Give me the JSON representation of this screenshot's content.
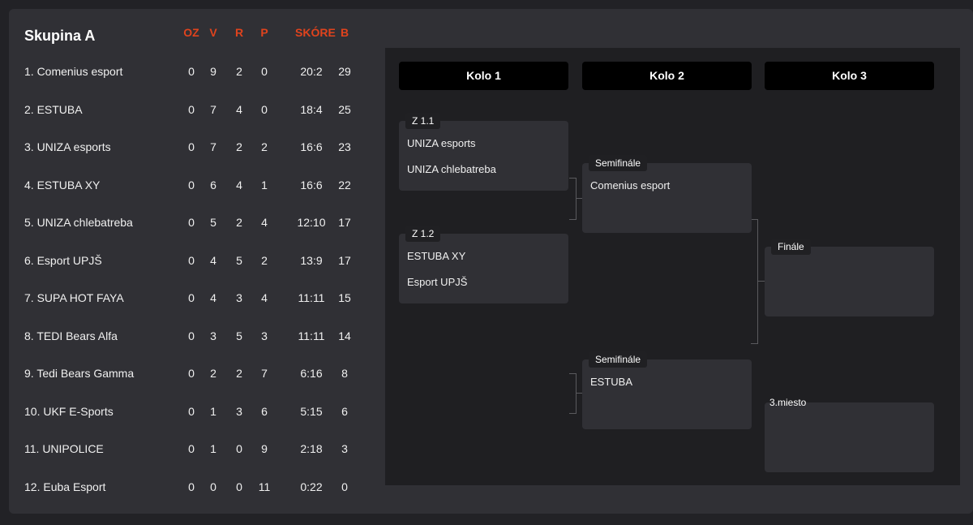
{
  "group": {
    "title": "Skupina A",
    "headers": [
      "OZ",
      "V",
      "R",
      "P",
      "SKÓRE",
      "B"
    ],
    "rows": [
      {
        "name": "1. Comenius esport",
        "oz": "0",
        "v": "9",
        "r": "2",
        "p": "0",
        "score": "20:2",
        "b": "29"
      },
      {
        "name": "2. ESTUBA",
        "oz": "0",
        "v": "7",
        "r": "4",
        "p": "0",
        "score": "18:4",
        "b": "25"
      },
      {
        "name": "3. UNIZA esports",
        "oz": "0",
        "v": "7",
        "r": "2",
        "p": "2",
        "score": "16:6",
        "b": "23"
      },
      {
        "name": "4. ESTUBA XY",
        "oz": "0",
        "v": "6",
        "r": "4",
        "p": "1",
        "score": "16:6",
        "b": "22"
      },
      {
        "name": "5. UNIZA chlebatreba",
        "oz": "0",
        "v": "5",
        "r": "2",
        "p": "4",
        "score": "12:10",
        "b": "17"
      },
      {
        "name": "6. Esport UPJŠ",
        "oz": "0",
        "v": "4",
        "r": "5",
        "p": "2",
        "score": "13:9",
        "b": "17"
      },
      {
        "name": "7. SUPA HOT FAYA",
        "oz": "0",
        "v": "4",
        "r": "3",
        "p": "4",
        "score": "11:11",
        "b": "15"
      },
      {
        "name": "8. TEDI Bears Alfa",
        "oz": "0",
        "v": "3",
        "r": "5",
        "p": "3",
        "score": "11:11",
        "b": "14"
      },
      {
        "name": "9. Tedi Bears Gamma",
        "oz": "0",
        "v": "2",
        "r": "2",
        "p": "7",
        "score": "6:16",
        "b": "8"
      },
      {
        "name": "10. UKF E-Sports",
        "oz": "0",
        "v": "1",
        "r": "3",
        "p": "6",
        "score": "5:15",
        "b": "6"
      },
      {
        "name": "11. UNIPOLICE",
        "oz": "0",
        "v": "1",
        "r": "0",
        "p": "9",
        "score": "2:18",
        "b": "3"
      },
      {
        "name": "12. Euba Esport",
        "oz": "0",
        "v": "0",
        "r": "0",
        "p": "11",
        "score": "0:22",
        "b": "0"
      }
    ]
  },
  "bracket": {
    "rounds": [
      "Kolo 1",
      "Kolo 2",
      "Kolo 3"
    ],
    "matches": [
      {
        "label": "Z 1.1",
        "team1": "UNIZA esports",
        "team2": "UNIZA chlebatreba"
      },
      {
        "label": "Z 1.2",
        "team1": "ESTUBA XY",
        "team2": "Esport UPJŠ"
      },
      {
        "label": "Semifinále",
        "team1": "Comenius esport",
        "team2": ""
      },
      {
        "label": "Semifinále",
        "team1": "ESTUBA",
        "team2": ""
      },
      {
        "label": "Finále",
        "team1": "",
        "team2": ""
      },
      {
        "label": "3.miesto",
        "team1": "",
        "team2": ""
      }
    ]
  },
  "colors": {
    "header_accent": "#e0431d",
    "panel_bg": "#303035",
    "bracket_bg": "#1f1f22",
    "round_header_bg": "#000000"
  }
}
